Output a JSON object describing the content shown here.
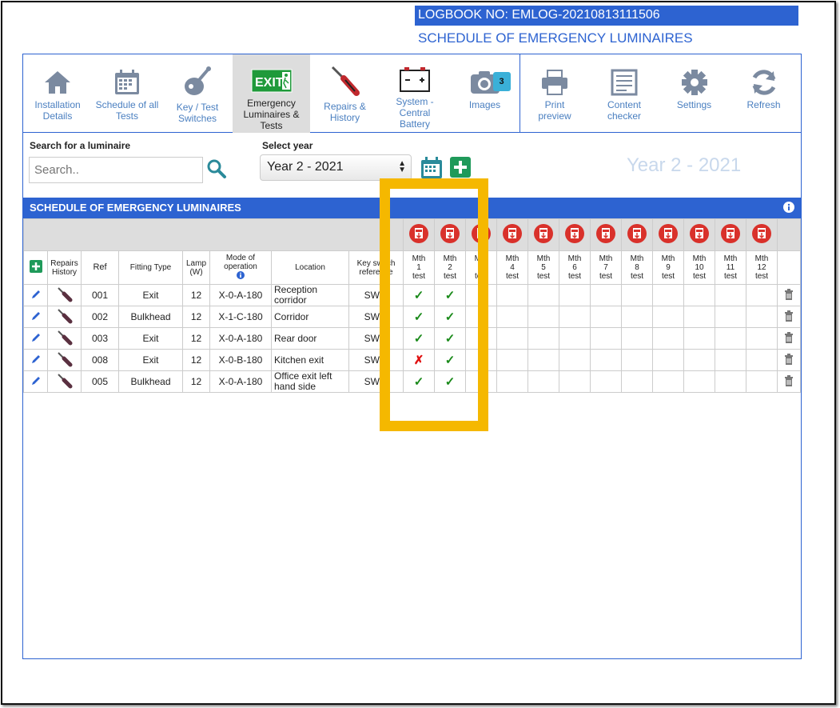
{
  "header": {
    "logbook": "LOGBOOK NO: EMLOG-20210813111506",
    "title": "SCHEDULE OF EMERGENCY LUMINAIRES"
  },
  "toolbar": [
    {
      "label": "Installation Details",
      "icon": "home-icon"
    },
    {
      "label": "Schedule of all Tests",
      "icon": "calendar-icon"
    },
    {
      "label": "Key / Test Switches",
      "icon": "key-switch-icon"
    },
    {
      "label": "Emergency Luminaires & Tests",
      "icon": "exit-sign-icon",
      "active": true
    },
    {
      "label": "Repairs & History",
      "icon": "screwdriver-icon"
    },
    {
      "label": "System - Central Battery",
      "icon": "battery-icon"
    },
    {
      "label": "Images",
      "icon": "camera-icon",
      "badge": "3"
    },
    {
      "label": "Print preview",
      "icon": "printer-icon"
    },
    {
      "label": "Content checker",
      "icon": "checklist-icon"
    },
    {
      "label": "Settings",
      "icon": "gear-icon"
    },
    {
      "label": "Refresh",
      "icon": "refresh-icon"
    }
  ],
  "search": {
    "label": "Search for a luminaire",
    "placeholder": "Search.."
  },
  "year": {
    "label": "Select year",
    "selected": "Year 2 - 2021",
    "display": "Year 2 - 2021"
  },
  "section_title": "SCHEDULE OF EMERGENCY LUMINAIRES",
  "columns": {
    "repairs": "Repairs History",
    "ref": "Ref",
    "fitting": "Fitting Type",
    "lamp": "Lamp (W)",
    "mode": "Mode of operation",
    "location": "Location",
    "keyswitch": "Key switch reference",
    "months": [
      "Mth 1 test",
      "Mth 2 test",
      "Mth 3 test",
      "Mth 4 test",
      "Mth 5 test",
      "Mth 6 test",
      "Mth 7 test",
      "Mth 8 test",
      "Mth 9 test",
      "Mth 10 test",
      "Mth 11 test",
      "Mth 12 test"
    ]
  },
  "rows": [
    {
      "ref": "001",
      "fitting": "Exit",
      "lamp": "12",
      "mode": "X-0-A-180",
      "location": "Reception corridor",
      "keyswitch": "SW-1",
      "results": [
        "pass",
        "pass"
      ]
    },
    {
      "ref": "002",
      "fitting": "Bulkhead",
      "lamp": "12",
      "mode": "X-1-C-180",
      "location": "Corridor",
      "keyswitch": "SW-2",
      "results": [
        "pass",
        "pass"
      ]
    },
    {
      "ref": "003",
      "fitting": "Exit",
      "lamp": "12",
      "mode": "X-0-A-180",
      "location": "Rear door",
      "keyswitch": "SW-1",
      "results": [
        "pass",
        "pass"
      ]
    },
    {
      "ref": "008",
      "fitting": "Exit",
      "lamp": "12",
      "mode": "X-0-B-180",
      "location": "Kitchen exit",
      "keyswitch": "SW-2",
      "results": [
        "fail",
        "pass"
      ]
    },
    {
      "ref": "005",
      "fitting": "Bulkhead",
      "lamp": "12",
      "mode": "X-0-A-180",
      "location": "Office exit left hand side",
      "keyswitch": "SW-1",
      "results": [
        "pass",
        "pass"
      ]
    }
  ],
  "colors": {
    "accent": "#2d63d1",
    "highlight": "#f5b800",
    "pass": "#1a8a1a",
    "fail": "#e01010",
    "pdf": "#d9312b"
  }
}
